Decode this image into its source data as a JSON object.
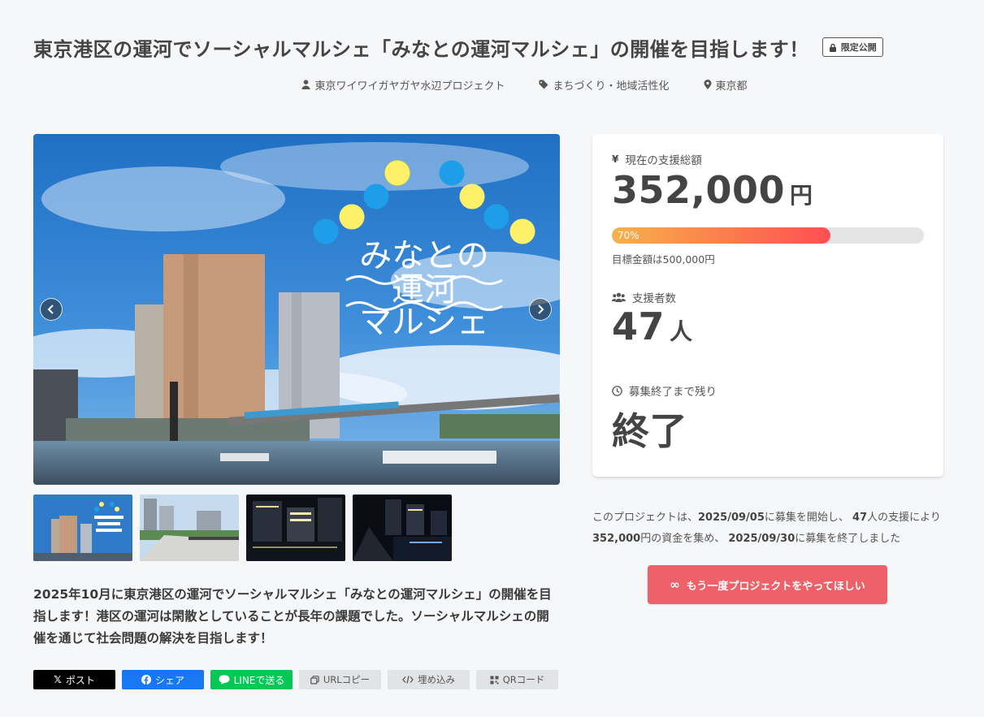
{
  "project": {
    "title": "東京港区の運河でソーシャルマルシェ「みなとの運河マルシェ」の開催を目指します！",
    "badge": "限定公開",
    "owner": "東京ワイワイガヤガヤ水辺プロジェクト",
    "category": "まちづくり・地域活性化",
    "location": "東京都"
  },
  "hero": {
    "logo_lines": [
      "みなとの",
      "運河",
      "マルシェ"
    ]
  },
  "summary": "2025年10月に東京港区の運河でソーシャルマルシェ「みなとの運河マルシェ」の開催を目指します！港区の運河は閑散としていることが長年の課題でした。ソーシャルマルシェの開催を通じて社会問題の解決を目指します！",
  "share": {
    "x": "ポスト",
    "facebook": "シェア",
    "line": "LINEで送る",
    "url": "URLコピー",
    "embed": "埋め込み",
    "qr": "QRコード"
  },
  "stats": {
    "total_label": "現在の支援総額",
    "total_value": "352,000",
    "total_unit": "円",
    "progress_label": "70%",
    "progress_fraction": 0.7,
    "goal": "目標金額は500,000円",
    "supporters_label": "支援者数",
    "supporters_value": "47",
    "supporters_unit": "人",
    "remaining_label": "募集終了まで残り",
    "remaining_value": "終了"
  },
  "result": {
    "p1": "このプロジェクトは、",
    "start_date": "2025/09/05",
    "p2": "に募集を開始し、",
    "supporters": "47",
    "p3": "人の支援により",
    "amount": "352,000",
    "p4": "円の資金を集め、",
    "end_date": "2025/09/30",
    "p5": "に募集を終了しました"
  },
  "again_button": "もう一度プロジェクトをやってほしい",
  "colors": {
    "accent": "#ef6169",
    "progress_start": "#f7b24a",
    "progress_end": "#ff4e52",
    "x": "#000000",
    "facebook": "#1877f2",
    "line": "#06c755"
  }
}
